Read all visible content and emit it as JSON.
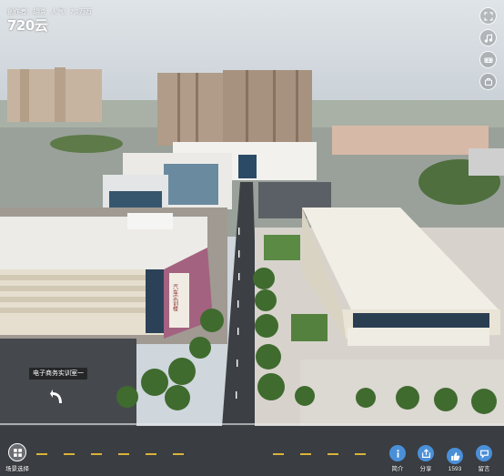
{
  "top": {
    "author_label": "创作者：胡晓",
    "views_label": "人气：7.1万万",
    "logo_text": "720云"
  },
  "right_toolbar": [
    {
      "icon": "fullscreen-icon"
    },
    {
      "icon": "music-icon"
    },
    {
      "icon": "vr-glasses-icon"
    },
    {
      "icon": "gyroscope-icon"
    }
  ],
  "hotspot": {
    "label": "电子商务实训室一"
  },
  "building_sign": "汽车实训楼",
  "bottom": {
    "scene_select_label": "场景选择",
    "intro_label": "简介",
    "share_label": "分享",
    "likes_count": "1593",
    "comment_label": "留言"
  }
}
